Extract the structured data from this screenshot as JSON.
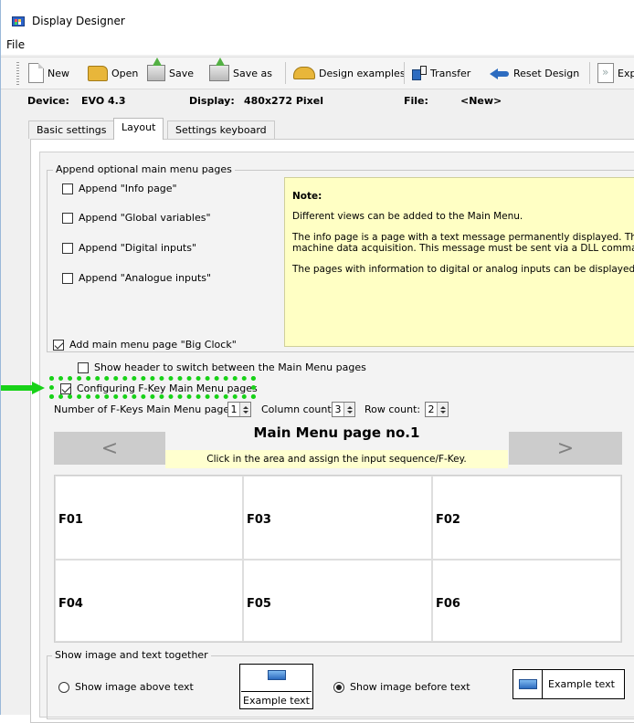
{
  "window": {
    "title": "Display Designer"
  },
  "menu": {
    "file": "File"
  },
  "toolbar": {
    "new": "New",
    "open": "Open",
    "save": "Save",
    "save_as": "Save as",
    "design_examples": "Design examples",
    "transfer": "Transfer",
    "reset_design": "Reset Design",
    "export": "Exp"
  },
  "device_bar": {
    "device_label": "Device:",
    "device_value": "EVO 4.3",
    "display_label": "Display:",
    "display_value": "480x272 Pixel",
    "file_label": "File:",
    "file_value": "<New>"
  },
  "tabs": [
    {
      "label": "Basic settings",
      "active": false
    },
    {
      "label": "Layout",
      "active": true
    },
    {
      "label": "Settings keyboard",
      "active": false
    }
  ],
  "append_group": {
    "title": "Append optional main menu pages",
    "items": [
      {
        "label": "Append \"Info page\"",
        "checked": false
      },
      {
        "label": "Append \"Global variables\"",
        "checked": false
      },
      {
        "label": "Append \"Digital inputs\"",
        "checked": false
      },
      {
        "label": "Append \"Analogue inputs\"",
        "checked": false
      }
    ]
  },
  "note": {
    "title": "Note:",
    "line1": "Different views can be added to the Main Menu.",
    "line2a": "The info page is a page with a text message permanently displayed. The sta",
    "line2b": "machine data acquisition. This message must be sent via a DLL command to",
    "line3": "The pages with information to digital or analog inputs can be displayed only"
  },
  "options": {
    "big_clock": {
      "label": "Add main menu page \"Big Clock\"",
      "checked": true
    },
    "show_header": {
      "label": "Show header to switch between the Main Menu pages",
      "checked": false
    },
    "fkey_config": {
      "label": "Configuring F-Key Main Menu pages",
      "checked": true
    }
  },
  "counts": {
    "fkey_pages_label": "Number of F-Keys Main Menu pages:",
    "fkey_pages_value": "1",
    "column_label": "Column count:",
    "column_value": "3",
    "row_label": "Row count:",
    "row_value": "2"
  },
  "main_menu": {
    "page_title": "Main Menu page no.1",
    "prev": "<",
    "next": ">",
    "hint": "Click in the area and assign the input sequence/F-Key.",
    "cells": [
      "F01",
      "F03",
      "F02",
      "F04",
      "F05",
      "F06"
    ]
  },
  "image_text_group": {
    "title": "Show image and text together",
    "above": {
      "label": "Show image above text",
      "selected": false
    },
    "before": {
      "label": "Show image before text",
      "selected": true
    },
    "example_text": "Example text"
  },
  "colors": {
    "highlight": "#18d218",
    "note_bg": "#ffffc4",
    "hint_bg": "#ffffcf"
  }
}
